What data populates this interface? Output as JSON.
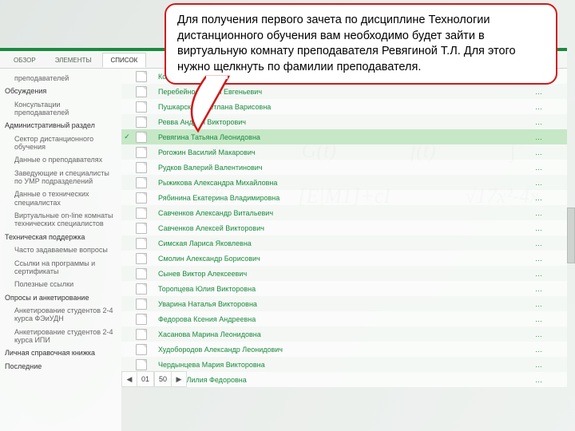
{
  "callout": "Для получения первого зачета по дисциплине Технологии дистанционного обучения вам необходимо будет зайти в виртуальную комнату преподавателя Ревягиной Т.Л. Для этого нужно щелкнуть по фамилии преподавателя.",
  "tabs": {
    "t0": "ОБЗОР",
    "t1": "ЭЛЕМЕНТЫ",
    "t2": "СПИСОК"
  },
  "sidebar": {
    "s0": "преподавателей",
    "s1": "Обсуждения",
    "s2": "Консультации преподавателей",
    "s3": "Административный раздел",
    "s4": "Сектор дистанционного обучения",
    "s5": "Данные о преподавателях",
    "s6": "Заведующие и специалисты по УМР подразделений",
    "s7": "Данные о технических специалистах",
    "s8": "Виртуальные on-line комнаты технических специалистов",
    "s9": "Техническая поддержка",
    "s10": "Часто задаваемые вопросы",
    "s11": "Ссылки на программы и сертификаты",
    "s12": "Полезные ссылки",
    "s13": "Опросы и анкетирование",
    "s14": "Анкетирование студентов 2-4 курса ФЭиУДН",
    "s15": "Анкетирование студентов 2-4 курса ИПИ",
    "s16": "Личная справочная книжка",
    "s17": "Последние"
  },
  "rows": {
    "r0": "Конькова Наталья Алексеевна",
    "r1": "Перебейнос Артем Евгеньевич",
    "r2": "Пушкарская Светлана Варисовна",
    "r3": "Ревва Андрей Викторович",
    "r4": "Ревягина Татьяна Леонидовна",
    "r5": "Рогожин Василий Макарович",
    "r6": "Рудков Валерий Валентинович",
    "r7": "Рыжикова Александра Михайловна",
    "r8": "Рябинина Екатерина Владимировна",
    "r9": "Савченков Александр Витальевич",
    "r10": "Савченков Алексей Викторович",
    "r11": "Симская Лариса Яковлевна",
    "r12": "Смолин Александр Борисович",
    "r13": "Сынев Виктор Алексеевич",
    "r14": "Торопцева Юлия Викторовна",
    "r15": "Уварина Наталья Викторовна",
    "r16": "Федорова Ксения Андреевна",
    "r17": "Хасанова Марина Леонидовна",
    "r18": "Худобородов Александр Леонидович",
    "r19": "Чердынцева Мария Викторовна",
    "r20": "Шарова Лилия Федоровна"
  },
  "dots": "…",
  "check": "✓",
  "pager": {
    "cur": "01",
    "total": "50"
  }
}
